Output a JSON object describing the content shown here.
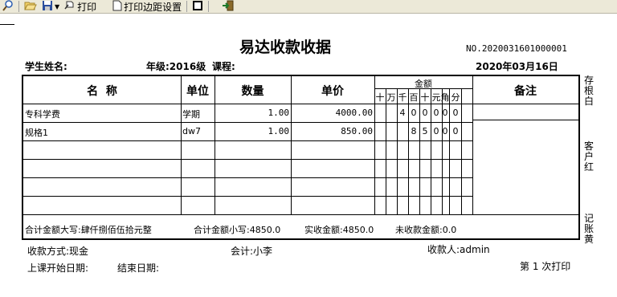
{
  "toolbar": {
    "print_label": "打印",
    "margin_label": "打印边距设置"
  },
  "receipt": {
    "title": "易达收款收据",
    "number": "NO.2020031601000001",
    "student_label": "学生姓名:",
    "grade_label": "年级:2016级",
    "course_label": "课程:",
    "date": "2020年03月16日"
  },
  "table": {
    "headers": {
      "name": "名  称",
      "unit": "单位",
      "qty": "数量",
      "price": "单价",
      "amount": "金额",
      "remark": "备注"
    },
    "digit_headers": [
      "十",
      "万",
      "千",
      "百",
      "十",
      "元",
      "角",
      "分"
    ],
    "rows": [
      {
        "name": "专科学费",
        "unit": "学期",
        "qty": "1.00",
        "price": "4000.00",
        "digits": [
          "",
          "",
          "4",
          "0",
          "0",
          "0",
          "0",
          "0"
        ]
      },
      {
        "name": "规格1",
        "unit": "dw7",
        "qty": "1.00",
        "price": "850.00",
        "digits": [
          "",
          "",
          "",
          "8",
          "5",
          "0",
          "0",
          "0"
        ]
      }
    ],
    "summary": {
      "total_caps": "合计金额大写:肆仟捌佰伍拾元整",
      "total_small": "合计金额小写:4850.0",
      "received": "实收金额:4850.0",
      "unreceived": "未收款金额:0.0"
    }
  },
  "side_labels": {
    "stub": [
      "存",
      "根",
      "白"
    ],
    "customer": [
      "客",
      "户",
      "红"
    ],
    "accounting": [
      "记",
      "账",
      "黄"
    ]
  },
  "footer": {
    "payment": "收款方式:现金",
    "accountant": "会计:小李",
    "payee": "收款人:admin",
    "start_date": "上课开始日期:",
    "end_date": "结束日期:",
    "print_count": "第 1 次打印"
  }
}
